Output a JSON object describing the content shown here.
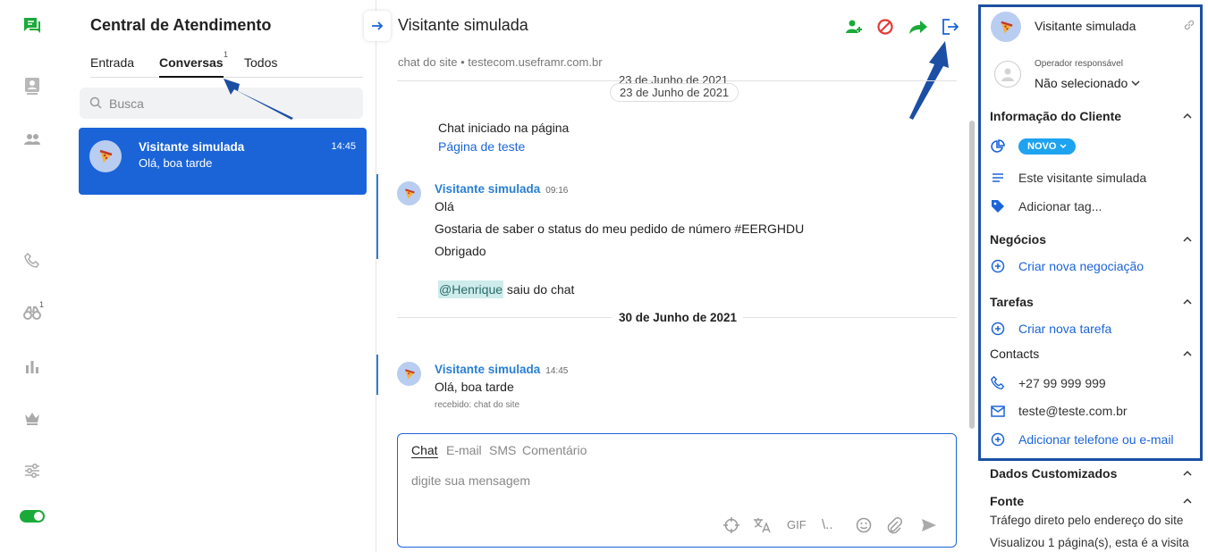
{
  "rail": {
    "notification_count": "1"
  },
  "inbox": {
    "title": "Central de Atendimento",
    "tabs": [
      {
        "label": "Entrada"
      },
      {
        "label": "Conversas",
        "badge": "1"
      },
      {
        "label": "Todos"
      }
    ],
    "search_placeholder": "Busca",
    "conversation": {
      "name": "Visitante simulada",
      "time": "14:45",
      "preview": "Olá, boa tarde"
    }
  },
  "chat": {
    "visitor_name": "Visitante simulada",
    "subtitle": "chat do site • testecom.useframr.com.br",
    "date_sticky_behind": "23 de Junho de 2021",
    "date_pill": "23 de Junho de 2021",
    "started_label": "Chat iniciado na página",
    "started_link": "Página de teste",
    "message1": {
      "sender": "Visitante simulada",
      "time": "09:16",
      "lines": [
        "Olá",
        "Gostaria de saber o status do meu pedido de número #EERGHDU",
        "Obrigado"
      ]
    },
    "mention": "@Henrique",
    "left_text": "saiu do chat",
    "date2": "30 de Junho de 2021",
    "message2": {
      "sender": "Visitante simulada",
      "time": "14:45",
      "text": "Olá, boa tarde",
      "meta": "recebido: chat do site"
    },
    "composer": {
      "tabs": [
        "Chat",
        "E-mail",
        "SMS",
        "Comentário"
      ],
      "placeholder": "digite sua mensagem",
      "tools": [
        "GIF",
        "\\.."
      ]
    }
  },
  "details": {
    "visitor_name": "Visitante simulada",
    "operator_label": "Operador responsável",
    "operator_value": "Não selecionado",
    "client_info_title": "Informação do Cliente",
    "status_badge": "NOVO",
    "visitor_desc": "Este visitante simulada",
    "add_tag": "Adicionar tag...",
    "deals_title": "Negócios",
    "new_deal": "Criar nova negociação",
    "tasks_title": "Tarefas",
    "new_task": "Criar nova tarefa",
    "contacts_title": "Contacts",
    "phone": "+27 99 999 999",
    "email": "teste@teste.com.br",
    "add_contact": "Adicionar telefone ou e-mail",
    "custom_title": "Dados Customizados",
    "source_title": "Fonte",
    "source_text": "Tráfego direto pelo endereço do site",
    "visits_text": "Visualizou 1 página(s), esta é a visita"
  },
  "colors": {
    "accent": "#1b64d8",
    "green": "#1aaa3a",
    "red": "#e53935",
    "annotation": "#1b4fa3"
  }
}
